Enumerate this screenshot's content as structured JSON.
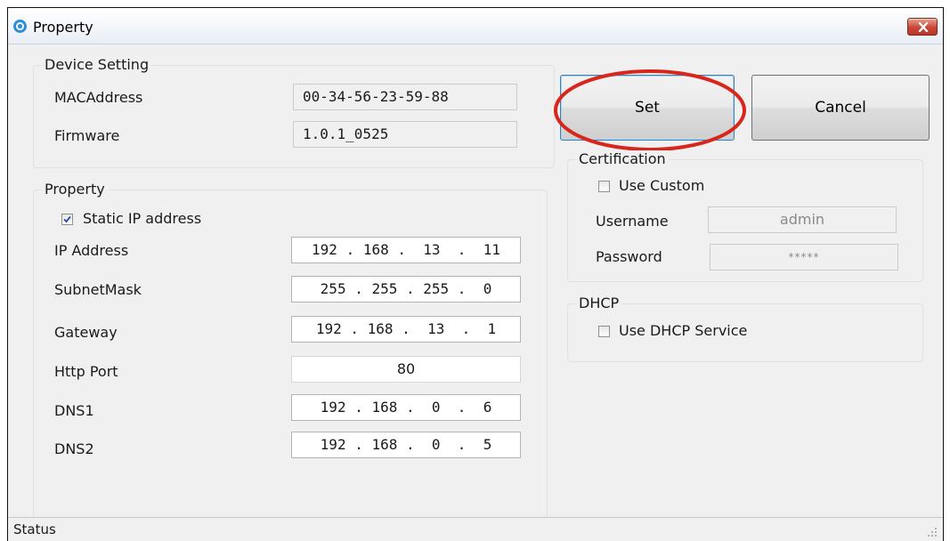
{
  "window": {
    "title": "Property",
    "close_icon": "close-icon"
  },
  "device_setting": {
    "group_label": "Device Setting",
    "mac_label": "MACAddress",
    "mac_value": "00-34-56-23-59-88",
    "firmware_label": "Firmware",
    "firmware_value": "1.0.1_0525"
  },
  "property": {
    "group_label": "Property",
    "static_ip_label": "Static IP address",
    "static_ip_checked": true,
    "ip_label": "IP Address",
    "ip_value": "192 . 168 .  13  .  11",
    "subnet_label": "SubnetMask",
    "subnet_value": "255 . 255 . 255 .  0",
    "gateway_label": "Gateway",
    "gateway_value": "192 . 168 .  13  .  1",
    "http_port_label": "Http Port",
    "http_port_value": "80",
    "dns1_label": "DNS1",
    "dns1_value": "192 . 168 .  0  .  6",
    "dns2_label": "DNS2",
    "dns2_value": "192 . 168 .  0  .  5"
  },
  "buttons": {
    "set_label": "Set",
    "cancel_label": "Cancel"
  },
  "certification": {
    "group_label": "Certification",
    "use_custom_label": "Use Custom",
    "use_custom_checked": false,
    "username_label": "Username",
    "username_value": "admin",
    "password_label": "Password",
    "password_value": "*****"
  },
  "dhcp": {
    "group_label": "DHCP",
    "use_dhcp_label": "Use DHCP Service",
    "use_dhcp_checked": false
  },
  "status": {
    "text": "Status"
  },
  "colors": {
    "highlight_ellipse": "#d9261c",
    "close_button": "#c9473a",
    "checkmark": "#2a4c9c"
  }
}
